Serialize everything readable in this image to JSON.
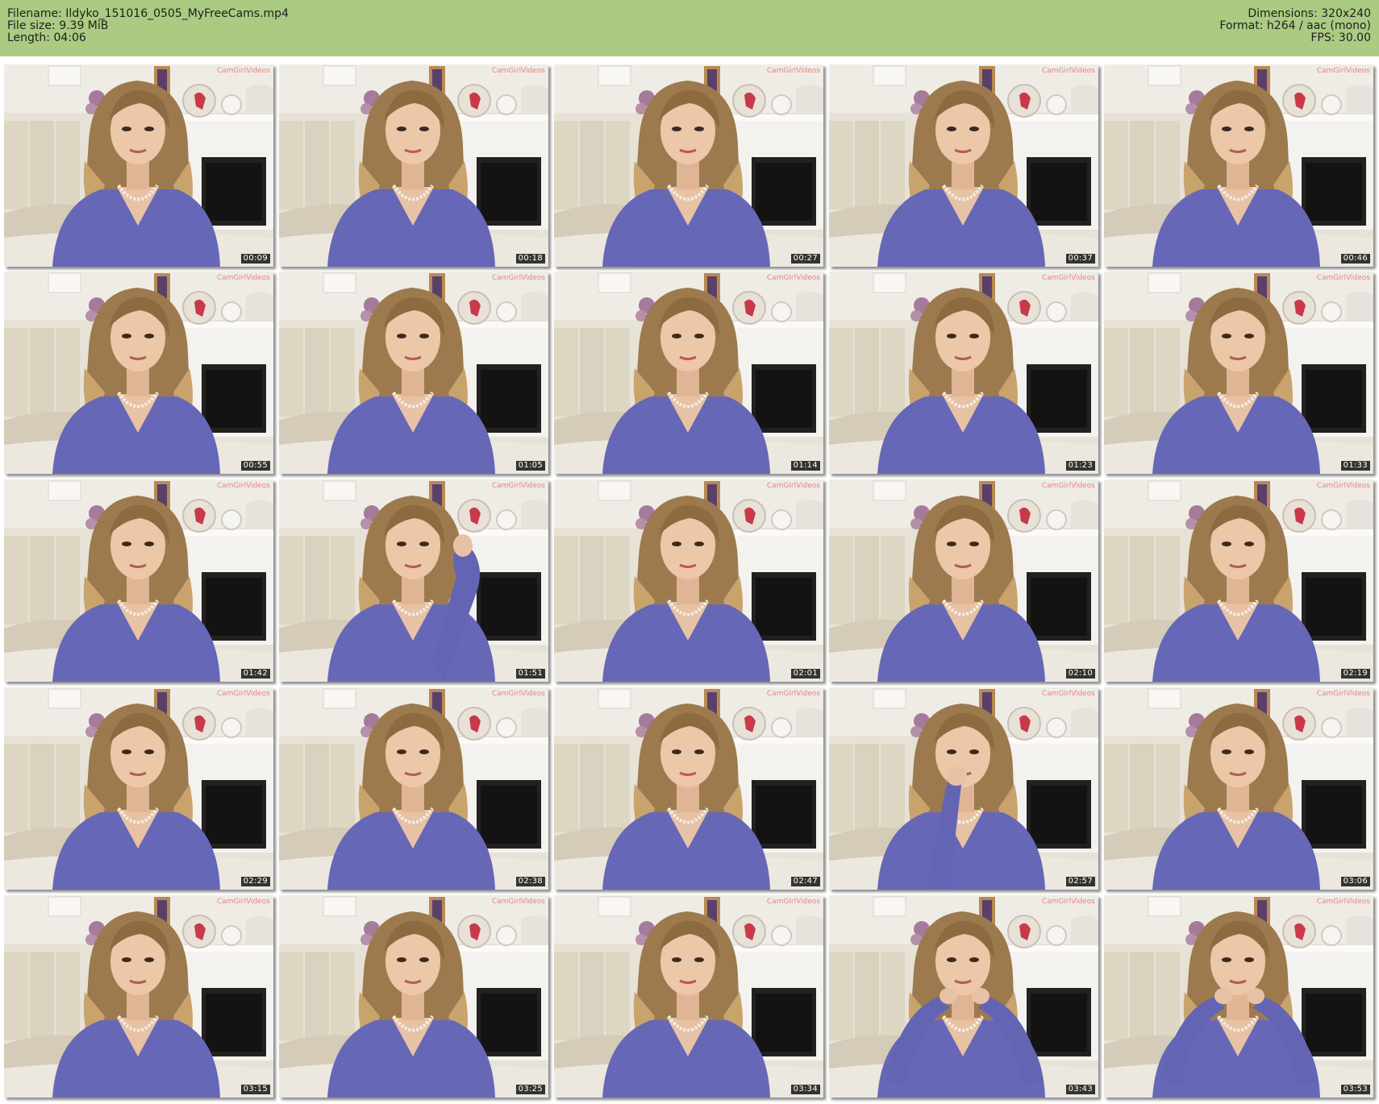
{
  "header": {
    "filename": "Filename: Ildyko_151016_0505_MyFreeCams.mp4",
    "file_size": "File size: 9.39 MiB",
    "length": "Length: 04:06",
    "dimensions": "Dimensions: 320x240",
    "format": "Format: h264 / aac (mono)",
    "fps": "FPS: 30.00",
    "bg_color": "#abcb82"
  },
  "watermark_text": "CamGirlVideos",
  "thumbnails": [
    {
      "time": "00:09",
      "variant": "default"
    },
    {
      "time": "00:18",
      "variant": "default"
    },
    {
      "time": "00:27",
      "variant": "default"
    },
    {
      "time": "00:37",
      "variant": "default"
    },
    {
      "time": "00:46",
      "variant": "default"
    },
    {
      "time": "00:55",
      "variant": "default"
    },
    {
      "time": "01:05",
      "variant": "default"
    },
    {
      "time": "01:14",
      "variant": "default"
    },
    {
      "time": "01:23",
      "variant": "default"
    },
    {
      "time": "01:33",
      "variant": "default"
    },
    {
      "time": "01:42",
      "variant": "default"
    },
    {
      "time": "01:51",
      "variant": "hand-hair"
    },
    {
      "time": "02:01",
      "variant": "default"
    },
    {
      "time": "02:10",
      "variant": "default"
    },
    {
      "time": "02:19",
      "variant": "default"
    },
    {
      "time": "02:29",
      "variant": "default"
    },
    {
      "time": "02:38",
      "variant": "default"
    },
    {
      "time": "02:47",
      "variant": "default"
    },
    {
      "time": "02:57",
      "variant": "hand-chin"
    },
    {
      "time": "03:06",
      "variant": "default"
    },
    {
      "time": "03:15",
      "variant": "default"
    },
    {
      "time": "03:25",
      "variant": "default"
    },
    {
      "time": "03:34",
      "variant": "default"
    },
    {
      "time": "03:43",
      "variant": "hands-hair"
    },
    {
      "time": "03:53",
      "variant": "hands-hair"
    }
  ]
}
